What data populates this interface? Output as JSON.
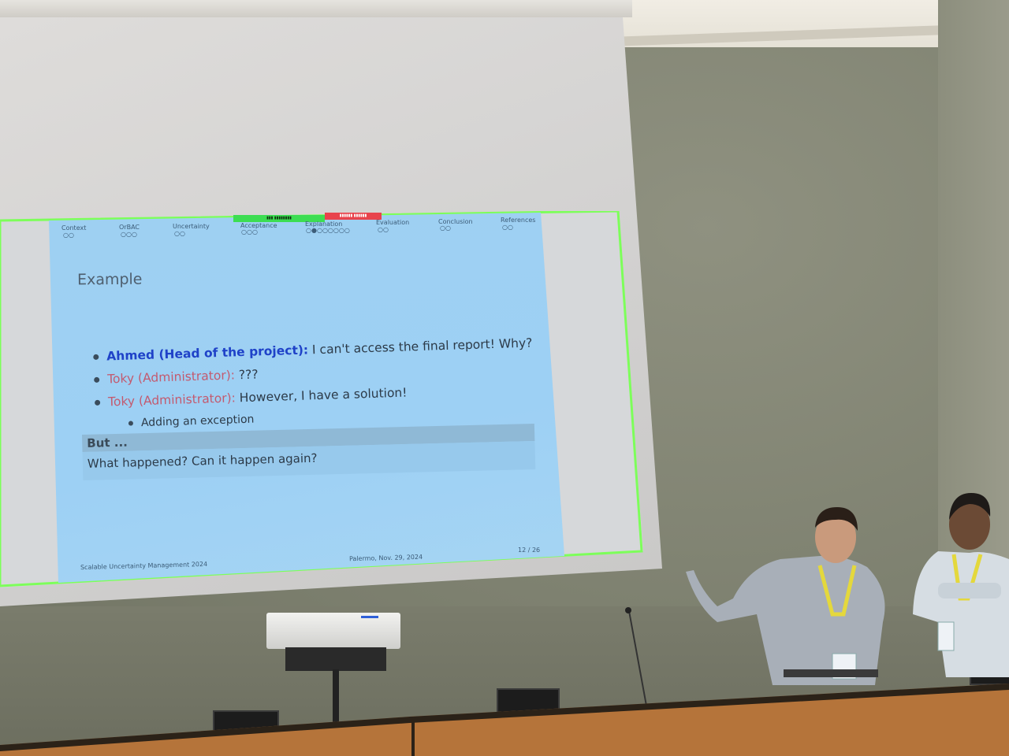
{
  "slide": {
    "nav_sections": [
      {
        "label": "Context",
        "dots": "○○"
      },
      {
        "label": "OrBAC",
        "dots": "○○○"
      },
      {
        "label": "Uncertainty",
        "dots": "○○"
      },
      {
        "label": "Acceptance",
        "dots": "○○○"
      },
      {
        "label": "Explanation",
        "dots": "○●○○○○○○"
      },
      {
        "label": "Evaluation",
        "dots": "○○"
      },
      {
        "label": "Conclusion",
        "dots": "○○"
      },
      {
        "label": "References",
        "dots": "○○"
      }
    ],
    "title": "Example",
    "bullets": [
      {
        "speaker": "Ahmed (Head of the project):",
        "text": " I can't access the final report! Why?"
      },
      {
        "speaker": "Toky (Administrator):",
        "text": " ???"
      },
      {
        "speaker": "Toky (Administrator):",
        "text": " However, I have a solution!"
      }
    ],
    "sub_bullet": "Adding an exception",
    "block": {
      "head": "But ...",
      "body": "What happened? Can it happen again?"
    },
    "footer": {
      "left": "Scalable Uncertainty Management 2024",
      "middle": "Palermo, Nov. 29, 2024",
      "right": "12 / 26"
    }
  },
  "colors": {
    "slide_background": "#9ed0f2",
    "frame_green": "#7dff5a",
    "speaker_blue": "#1f42c8",
    "speaker_pink": "#c35a6f",
    "wall": "#808272",
    "desk_wood": "#b5743a"
  }
}
